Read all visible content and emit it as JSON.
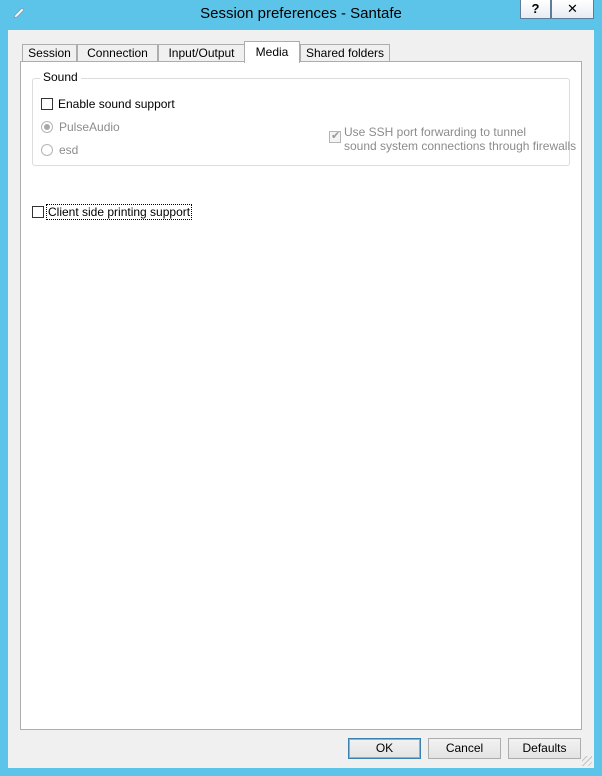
{
  "window": {
    "title": "Session preferences - Santafe"
  },
  "titlebar": {
    "help_label": "?",
    "close_label": "✕"
  },
  "tabs": [
    {
      "label": "Session"
    },
    {
      "label": "Connection"
    },
    {
      "label": "Input/Output"
    },
    {
      "label": "Media",
      "selected": true
    },
    {
      "label": "Shared folders"
    }
  ],
  "sound_group": {
    "title": "Sound",
    "enable_sound": {
      "label": "Enable sound support",
      "checked": false
    },
    "pulseaudio": {
      "label": "PulseAudio",
      "selected": true,
      "enabled": false
    },
    "esd": {
      "label": "esd",
      "selected": false,
      "enabled": false
    },
    "ssh_forwarding": {
      "line1": "Use SSH port forwarding to tunnel",
      "line2": "sound system connections through firewalls",
      "checked": true,
      "enabled": false
    }
  },
  "printing": {
    "label": "Client side printing support",
    "checked": false
  },
  "buttons": {
    "ok": "OK",
    "cancel": "Cancel",
    "defaults": "Defaults"
  },
  "icons": {
    "title_icon": "pencil-icon",
    "grip": "resize-grip-icon"
  }
}
